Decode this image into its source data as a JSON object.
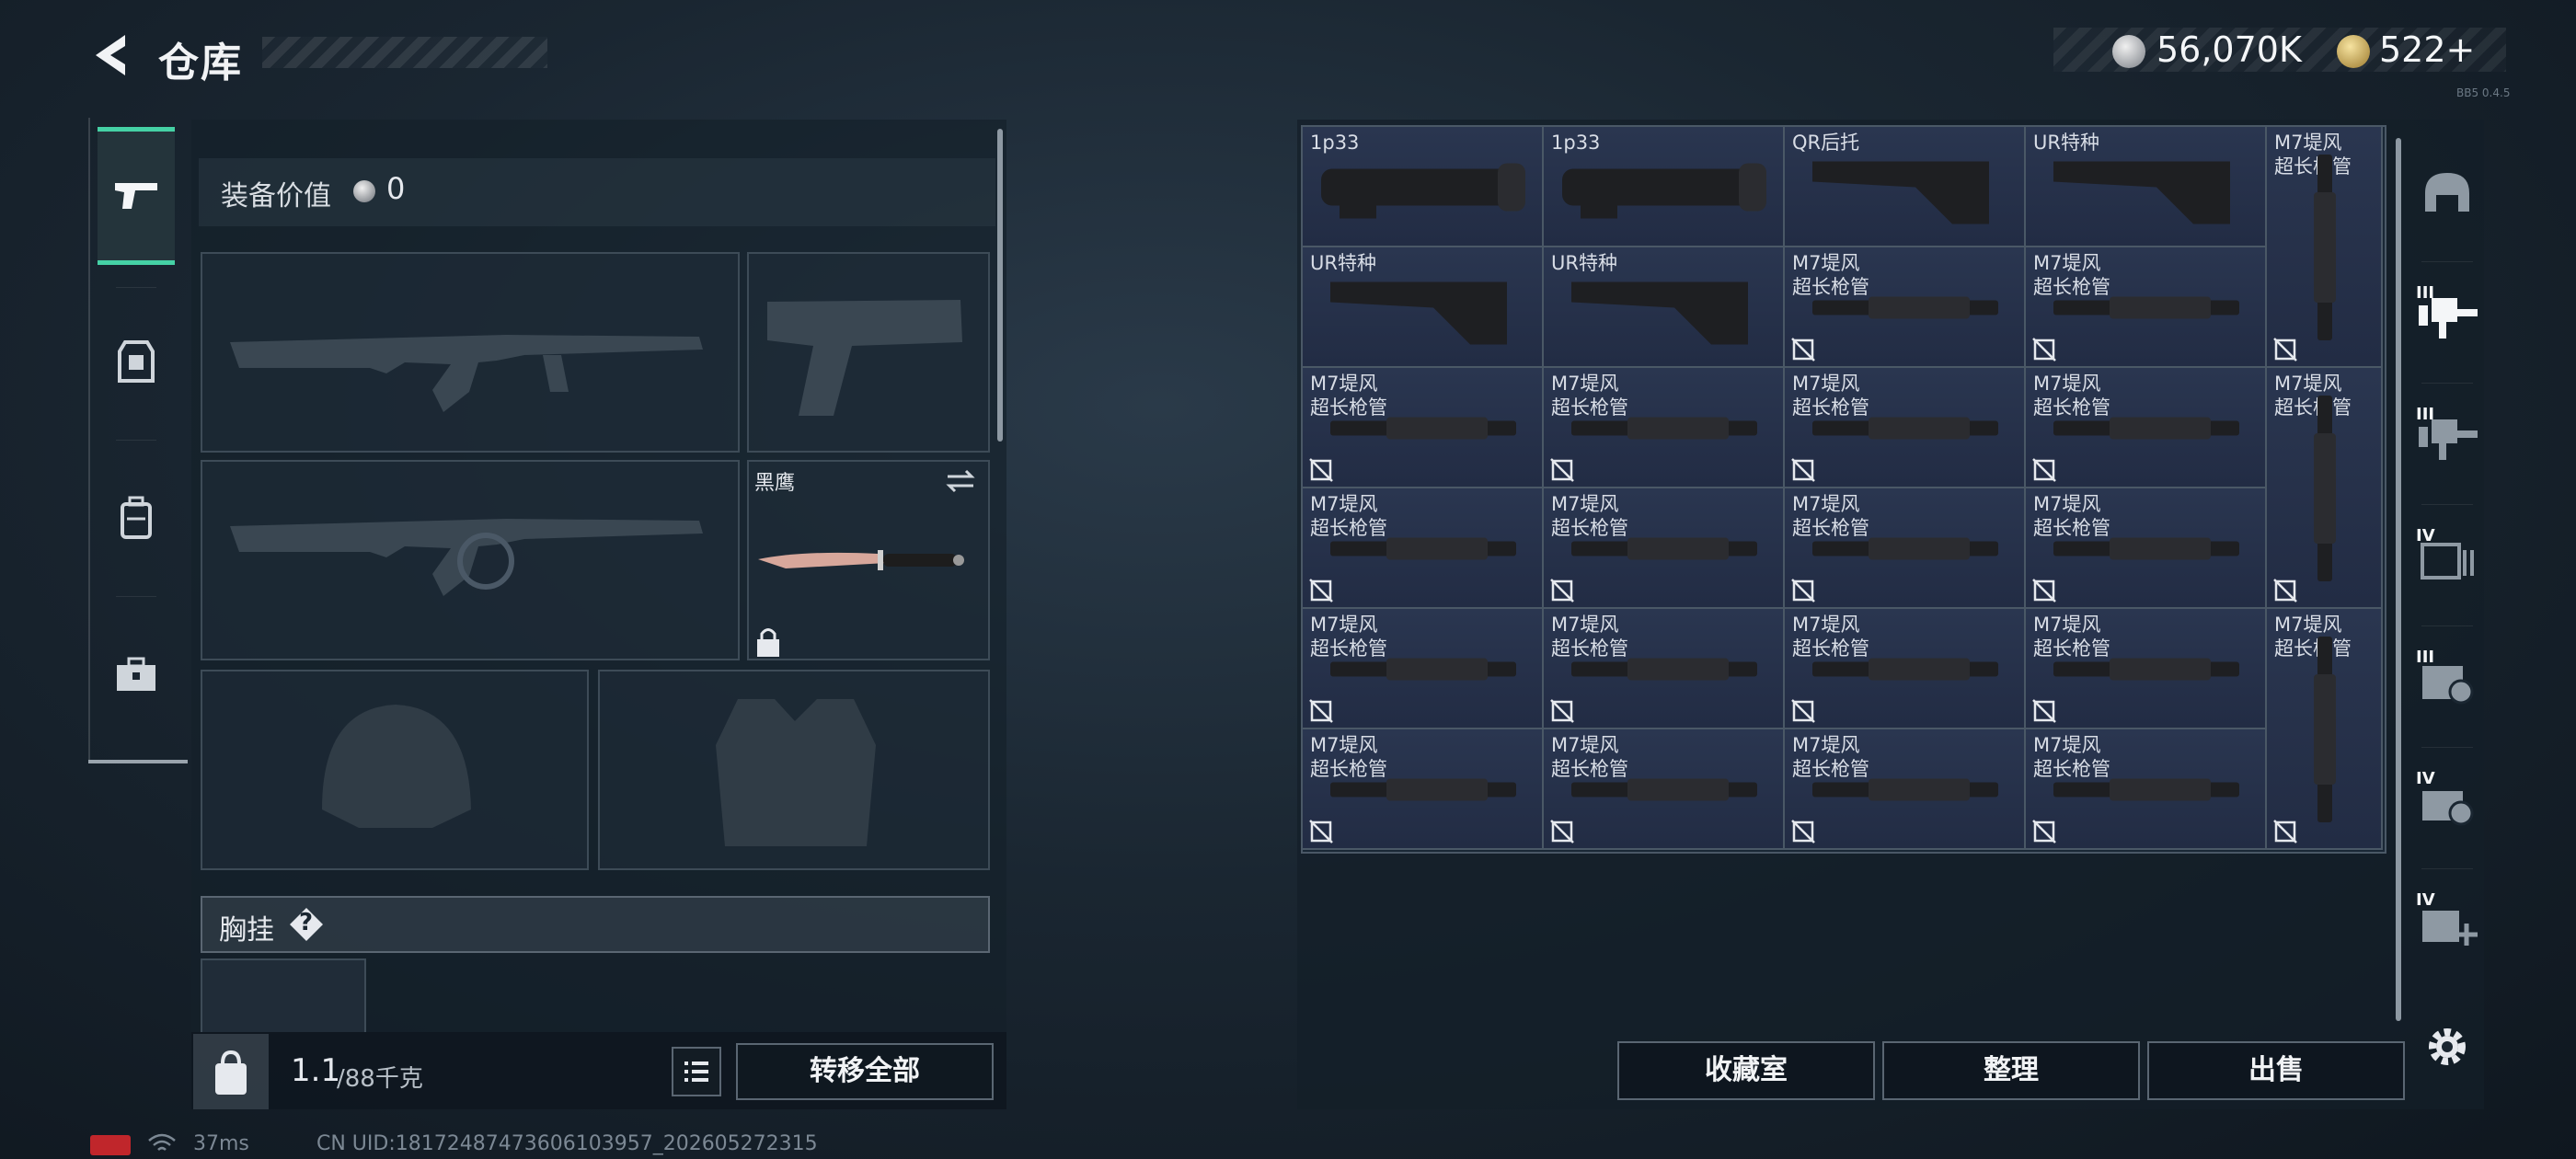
{
  "header": {
    "title": "仓库",
    "silver_value": "56,070K",
    "gold_value": "522+",
    "version_tag": "BB5 0.4.5"
  },
  "left_tabs": [
    {
      "icon": "pistol-icon",
      "active": true
    },
    {
      "icon": "armor-icon",
      "active": false
    },
    {
      "icon": "backpack-icon",
      "active": false
    },
    {
      "icon": "toolbox-icon",
      "active": false
    }
  ],
  "loadout": {
    "equip_value_label": "装备价值",
    "equip_value": "0",
    "melee_name": "黑鹰",
    "chest_label": "胸挂",
    "chest_help": "?",
    "weight_value": "1.1",
    "weight_cap": "/88千克",
    "transfer_all": "转移全部"
  },
  "grid": {
    "rows": [
      [
        {
          "name": "1p33",
          "type": "scope"
        },
        {
          "name": "1p33",
          "type": "scope"
        },
        {
          "name": "QR后托",
          "type": "stock-small"
        },
        {
          "name": "UR特种",
          "type": "stock"
        }
      ],
      [
        {
          "name": "UR特种",
          "type": "stock"
        },
        {
          "name": "UR特种",
          "type": "stock"
        },
        {
          "name": "M7堤风\n超长枪管",
          "type": "barrel"
        },
        {
          "name": "M7堤风\n超长枪管",
          "type": "barrel"
        }
      ],
      [
        {
          "name": "M7堤风\n超长枪管",
          "type": "barrel"
        },
        {
          "name": "M7堤风\n超长枪管",
          "type": "barrel"
        },
        {
          "name": "M7堤风\n超长枪管",
          "type": "barrel"
        },
        {
          "name": "M7堤风\n超长枪管",
          "type": "barrel"
        }
      ],
      [
        {
          "name": "M7堤风\n超长枪管",
          "type": "barrel"
        },
        {
          "name": "M7堤风\n超长枪管",
          "type": "barrel"
        },
        {
          "name": "M7堤风\n超长枪管",
          "type": "barrel"
        },
        {
          "name": "M7堤风\n超长枪管",
          "type": "barrel"
        }
      ],
      [
        {
          "name": "M7堤风\n超长枪管",
          "type": "barrel"
        },
        {
          "name": "M7堤风\n超长枪管",
          "type": "barrel"
        },
        {
          "name": "M7堤风\n超长枪管",
          "type": "barrel"
        },
        {
          "name": "M7堤风\n超长枪管",
          "type": "barrel"
        }
      ],
      [
        {
          "name": "M7堤风\n超长枪管",
          "type": "barrel"
        },
        {
          "name": "M7堤风\n超长枪管",
          "type": "barrel"
        },
        {
          "name": "M7堤风\n超长枪管",
          "type": "barrel"
        },
        {
          "name": "M7堤风\n超长枪管",
          "type": "barrel"
        }
      ]
    ],
    "tall_items": [
      {
        "name": "M7堤风\n超长枪管"
      },
      {
        "name": "M7堤风\n超长枪管"
      },
      {
        "name": "M7堤风\n超长枪管"
      }
    ]
  },
  "right_buttons": {
    "collection": "收藏室",
    "arrange": "整理",
    "sell": "出售"
  },
  "right_tabs": [
    {
      "icon": "helmet-icon",
      "label": ""
    },
    {
      "icon": "rifle-attachment-icon",
      "label": "III"
    },
    {
      "icon": "rifle-attachment-icon",
      "label": "III"
    },
    {
      "icon": "ammo-box-icon",
      "label": "IV"
    },
    {
      "icon": "medkit-icon",
      "label": "III"
    },
    {
      "icon": "grenade-icon",
      "label": "IV"
    },
    {
      "icon": "plus-item-icon",
      "label": "IV"
    }
  ],
  "status": {
    "ping": "37ms",
    "uid": "CN UID:18172487473606103957_202605272315"
  },
  "colors": {
    "accent": "#45d1a5",
    "panel": "#1a2836",
    "cell": "#262f48",
    "status_red": "#c0262b"
  }
}
